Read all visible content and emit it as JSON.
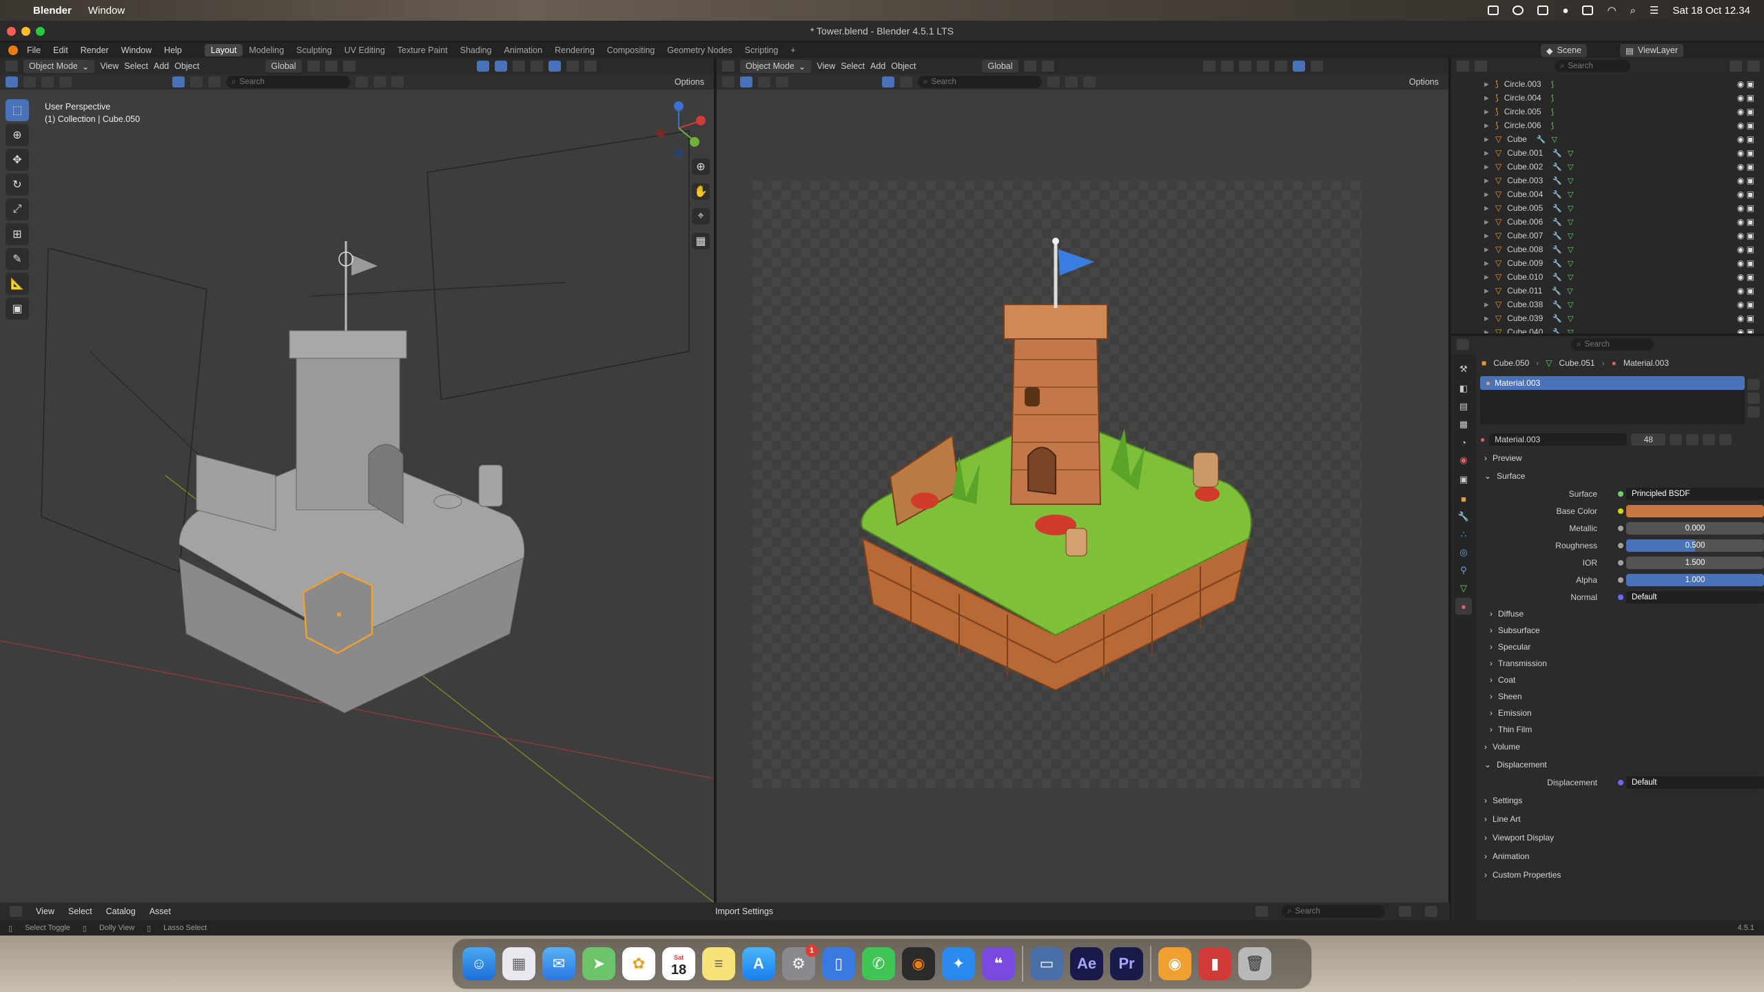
{
  "mac_menu": {
    "app": "Blender",
    "window": "Window",
    "date_time": "Sat 18 Oct  12.34"
  },
  "window": {
    "title": "* Tower.blend - Blender 4.5.1 LTS"
  },
  "top_menu": {
    "items": [
      "File",
      "Edit",
      "Render",
      "Window",
      "Help"
    ],
    "workspaces": [
      "Layout",
      "Modeling",
      "Sculpting",
      "UV Editing",
      "Texture Paint",
      "Shading",
      "Animation",
      "Rendering",
      "Compositing",
      "Geometry Nodes",
      "Scripting"
    ],
    "active_workspace": "Layout",
    "scene_label": "Scene",
    "viewlayer_label": "ViewLayer"
  },
  "viewport_left": {
    "mode": "Object Mode",
    "menus": [
      "View",
      "Select",
      "Add",
      "Object"
    ],
    "transform": "Global",
    "search_placeholder": "Search",
    "options_label": "Options",
    "perspective_label": "User Perspective",
    "collection_label": "(1) Collection | Cube.050"
  },
  "viewport_right": {
    "mode": "Object Mode",
    "menus": [
      "View",
      "Select",
      "Add",
      "Object"
    ],
    "transform": "Global",
    "search_placeholder": "Search",
    "options_label": "Options"
  },
  "outliner": {
    "search_placeholder": "Search",
    "rows": [
      {
        "name": "Circle.003",
        "type": "curve"
      },
      {
        "name": "Circle.004",
        "type": "curve"
      },
      {
        "name": "Circle.005",
        "type": "curve"
      },
      {
        "name": "Circle.006",
        "type": "curve"
      },
      {
        "name": "Cube",
        "type": "mesh"
      },
      {
        "name": "Cube.001",
        "type": "mesh"
      },
      {
        "name": "Cube.002",
        "type": "mesh"
      },
      {
        "name": "Cube.003",
        "type": "mesh"
      },
      {
        "name": "Cube.004",
        "type": "mesh"
      },
      {
        "name": "Cube.005",
        "type": "mesh"
      },
      {
        "name": "Cube.006",
        "type": "mesh"
      },
      {
        "name": "Cube.007",
        "type": "mesh"
      },
      {
        "name": "Cube.008",
        "type": "mesh"
      },
      {
        "name": "Cube.009",
        "type": "mesh"
      },
      {
        "name": "Cube.010",
        "type": "mesh"
      },
      {
        "name": "Cube.011",
        "type": "mesh"
      },
      {
        "name": "Cube.038",
        "type": "mesh"
      },
      {
        "name": "Cube.039",
        "type": "mesh"
      },
      {
        "name": "Cube.040",
        "type": "mesh"
      }
    ]
  },
  "properties": {
    "search_placeholder": "Search",
    "breadcrumb": [
      "Cube.050",
      "Cube.051",
      "Material.003"
    ],
    "material_slot": "Material.003",
    "material_name": "Material.003",
    "user_count": "48",
    "sections_top": [
      "Preview",
      "Surface"
    ],
    "surface_label": "Surface",
    "surface_value": "Principled BSDF",
    "fields": [
      {
        "label": "Base Color",
        "value": "",
        "kind": "color",
        "color": "#c7773f"
      },
      {
        "label": "Metallic",
        "value": "0.000",
        "kind": "num",
        "fill": 0.0
      },
      {
        "label": "Roughness",
        "value": "0.500",
        "kind": "num",
        "fill": 0.5
      },
      {
        "label": "IOR",
        "value": "1.500",
        "kind": "num",
        "fill": 0.0
      },
      {
        "label": "Alpha",
        "value": "1.000",
        "kind": "num",
        "fill": 1.0
      },
      {
        "label": "Normal",
        "value": "Default",
        "kind": "link"
      }
    ],
    "subsections": [
      "Diffuse",
      "Subsurface",
      "Specular",
      "Transmission",
      "Coat",
      "Sheen",
      "Emission",
      "Thin Film"
    ],
    "volume": "Volume",
    "displacement": "Displacement",
    "displacement_label": "Displacement",
    "displacement_value": "Default",
    "more_sections": [
      "Settings",
      "Line Art",
      "Viewport Display",
      "Animation",
      "Custom Properties"
    ]
  },
  "asset_bar": {
    "menus": [
      "View",
      "Select",
      "Catalog",
      "Asset"
    ],
    "import_settings": "Import Settings",
    "search_placeholder": "Search"
  },
  "status_bar": {
    "items": [
      "Select Toggle",
      "Dolly View",
      "Lasso Select"
    ],
    "version": "4.5.1"
  },
  "dock": {
    "calendar_day": "18",
    "calendar_month": "Sat",
    "badge": "1",
    "ae": "Ae",
    "pr": "Pr"
  },
  "colors": {
    "accent": "#4a72b8",
    "selection_orange": "#f0a030",
    "base_color": "#c7773f"
  }
}
